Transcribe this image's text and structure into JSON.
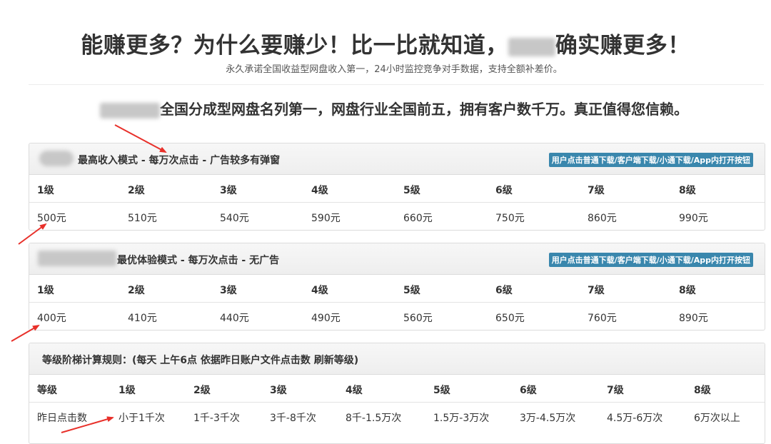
{
  "headline": {
    "before": "能赚更多？为什么要赚少！比一比就知道，",
    "after": "确实赚更多！"
  },
  "subline": "永久承诺全国收益型网盘收入第一，24小时监控竞争对手数据，支持全额补差价。",
  "tagline": "全国分成型网盘名列第一，网盘行业全国前五，拥有客户数千万。真正值得您信赖。",
  "panel1": {
    "title": "最高收入模式 - 每万次点击 - 广告较多有弹窗",
    "badge": "用户点击普通下载/客户端下载/小通下载/App内打开按钮",
    "levels": [
      "1级",
      "2级",
      "3级",
      "4级",
      "5级",
      "6级",
      "7级",
      "8级"
    ],
    "prices": [
      "500元",
      "510元",
      "540元",
      "590元",
      "660元",
      "750元",
      "860元",
      "990元"
    ]
  },
  "panel2": {
    "title": "最优体验模式 - 每万次点击 - 无广告",
    "badge": "用户点击普通下载/客户端下载/小通下载/App内打开按钮",
    "levels": [
      "1级",
      "2级",
      "3级",
      "4级",
      "5级",
      "6级",
      "7级",
      "8级"
    ],
    "prices": [
      "400元",
      "410元",
      "440元",
      "490元",
      "560元",
      "650元",
      "760元",
      "890元"
    ]
  },
  "panel3": {
    "title": "等级阶梯计算规则：(每天 上午6点 依据昨日账户文件点击数 刷新等级)",
    "header": [
      "等级",
      "1级",
      "2级",
      "3级",
      "4级",
      "5级",
      "6级",
      "7级",
      "8级"
    ],
    "values": [
      "昨日点击数",
      "小于1千次",
      "1千-3千次",
      "3千-8千次",
      "8千-1.5万次",
      "1.5万-3万次",
      "3万-4.5万次",
      "4.5万-6万次",
      "6万次以上"
    ]
  },
  "colors": {
    "badge": "#3a87ad",
    "arrow": "#e8302a",
    "text": "#333333"
  }
}
